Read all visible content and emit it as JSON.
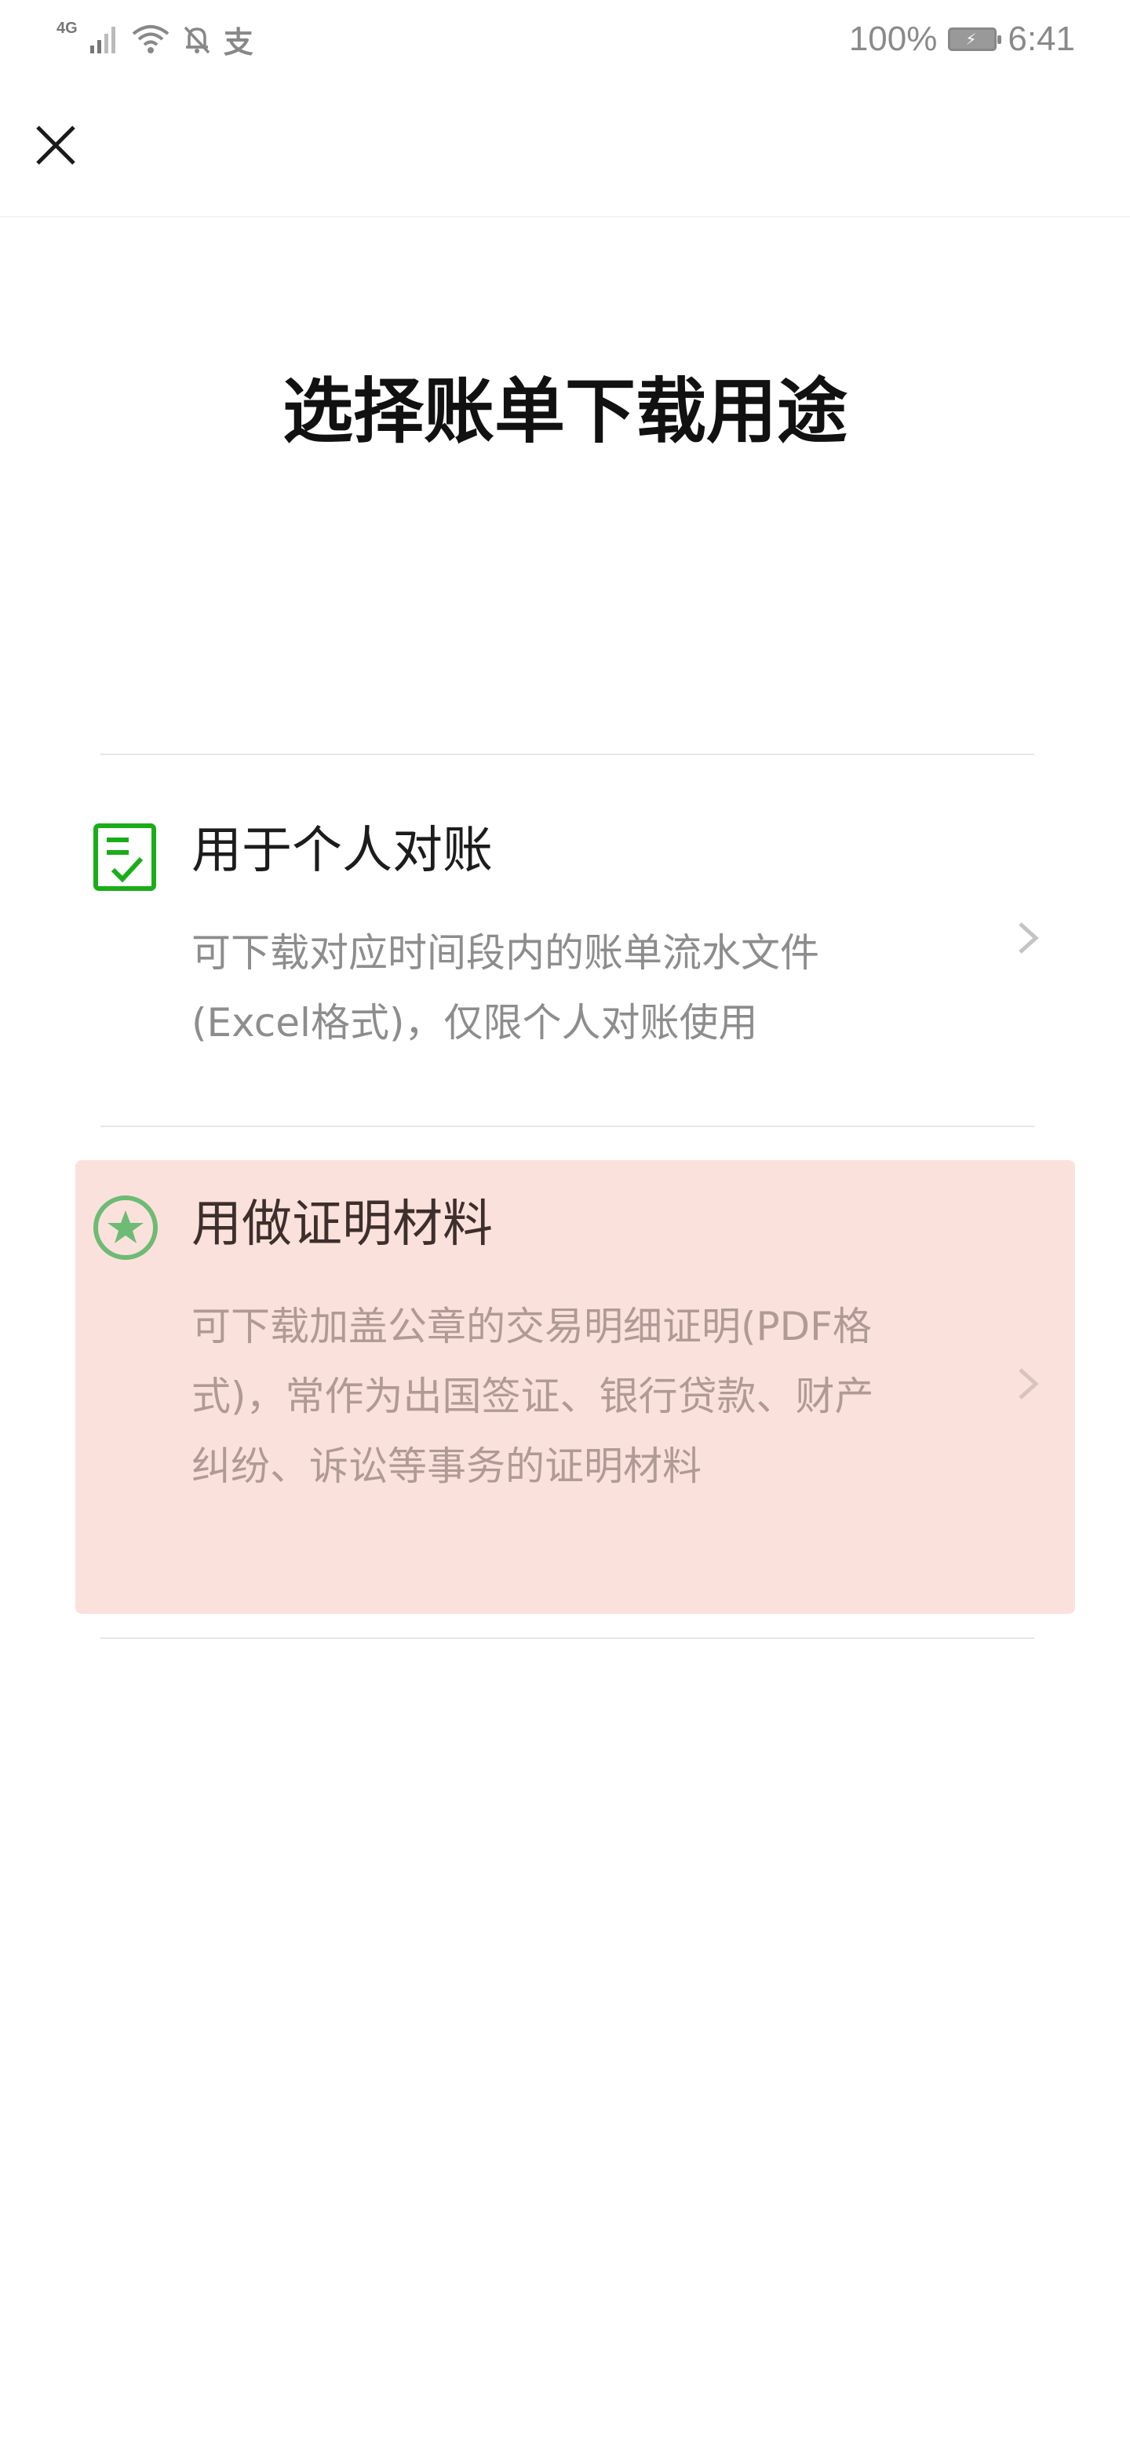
{
  "status_bar": {
    "network": "4G",
    "carrier_app_icon": "支",
    "battery_percent": "100%",
    "time": "6:41",
    "icons": [
      "signal-icon",
      "wifi-icon",
      "bell-muted-icon",
      "alipay-icon",
      "battery-icon"
    ]
  },
  "nav": {
    "close_icon": "close-icon"
  },
  "page": {
    "title": "选择账单下载用途"
  },
  "options": [
    {
      "title": "用于个人对账",
      "description": "可下载对应时间段内的账单流水文件(Excel格式)，仅限个人对账使用",
      "icon": "document-check-icon",
      "highlighted": false
    },
    {
      "title": "用做证明材料",
      "description": "可下载加盖公章的交易明细证明(PDF格式)，常作为出国签证、银行贷款、财产纠纷、诉讼等事务的证明材料",
      "icon": "star-seal-icon",
      "highlighted": true
    }
  ],
  "colors": {
    "accent_green": "#1aad19",
    "highlight_bg": "#fbe1dc",
    "divider": "#e6e6e6"
  }
}
